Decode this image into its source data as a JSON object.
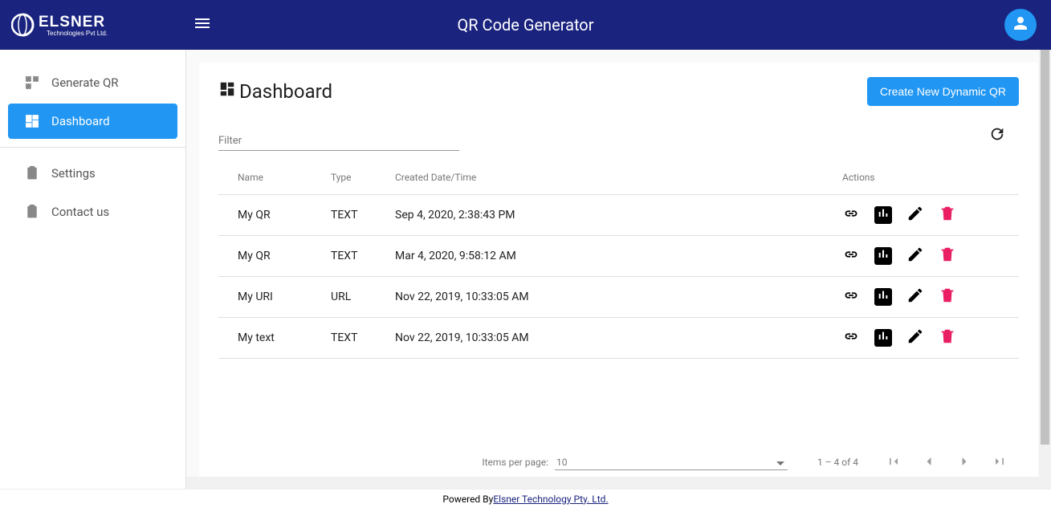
{
  "header": {
    "logo_text_main": "ELSNER",
    "logo_text_sub": "Technologies Pvt Ltd.",
    "app_title": "QR Code Generator"
  },
  "sidebar": {
    "items": [
      {
        "label": "Generate QR",
        "icon": "qr"
      },
      {
        "label": "Dashboard",
        "icon": "dashboard",
        "active": true
      },
      {
        "label": "Settings",
        "icon": "clipboard"
      },
      {
        "label": "Contact us",
        "icon": "clipboard"
      }
    ]
  },
  "dashboard": {
    "title": "Dashboard",
    "create_button": "Create New Dynamic QR",
    "filter_label": "Filter",
    "table": {
      "headers": {
        "name": "Name",
        "type": "Type",
        "created": "Created Date/Time",
        "actions": "Actions"
      },
      "rows": [
        {
          "name": "My QR",
          "type": "TEXT",
          "created": "Sep 4, 2020, 2:38:43 PM"
        },
        {
          "name": "My QR",
          "type": "TEXT",
          "created": "Mar 4, 2020, 9:58:12 AM"
        },
        {
          "name": "My URI",
          "type": "URL",
          "created": "Nov 22, 2019, 10:33:05 AM"
        },
        {
          "name": "My text",
          "type": "TEXT",
          "created": "Nov 22, 2019, 10:33:05 AM"
        }
      ]
    },
    "paginator": {
      "items_per_page_label": "Items per page:",
      "page_size": "10",
      "range_label": "1 – 4 of 4"
    }
  },
  "footer": {
    "powered_by": "Powered By ",
    "company": "Elsner Technology Pty. Ltd."
  }
}
